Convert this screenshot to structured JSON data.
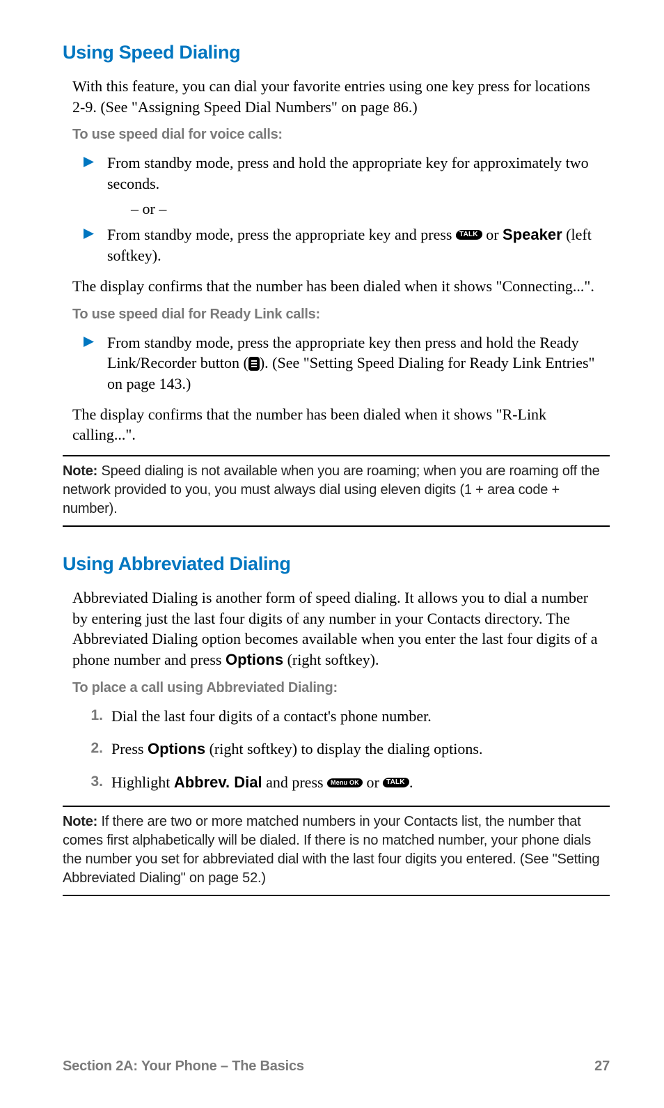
{
  "section1": {
    "heading": "Using Speed Dialing",
    "intro": "With this feature, you can dial your favorite entries using one key press for locations 2-9. (See \"Assigning Speed Dial Numbers\" on page 86.)",
    "voice_sub": "To use speed dial for voice calls:",
    "voice_b1": "From standby mode, press and hold the appropriate key for approximately two seconds.",
    "or": "– or –",
    "voice_b2_a": "From standby mode, press the appropriate key and press ",
    "talk_label": "TALK",
    "voice_b2_b": " or ",
    "speaker_bold": "Speaker",
    "voice_b2_c": " (left softkey).",
    "confirm1": "The display confirms that the number has been dialed when it shows \"Connecting...\".",
    "rl_sub": "To use speed dial for Ready Link calls:",
    "rl_b1_a": "From standby mode, press the appropriate key then press and hold the Ready Link/Recorder button (",
    "rl_b1_b": "). (See \"Setting Speed Dialing for Ready Link Entries\" on page 143.)",
    "confirm2": "The display confirms that the number has been dialed when it shows \"R-Link calling...\".",
    "note_label": "Note:",
    "note_text": " Speed dialing is not available when you are roaming; when you are roaming off the network provided to you, you must always dial using eleven digits (1 + area code + number)."
  },
  "section2": {
    "heading": "Using Abbreviated Dialing",
    "intro_a": "Abbreviated Dialing is another form of speed dialing. It allows you to dial a number by entering just the last four digits of any number in your Contacts directory. The Abbreviated Dialing option becomes available when you enter the last four digits of a phone number and press ",
    "options_bold": "Options",
    "intro_b": " (right softkey).",
    "sub": "To place a call using Abbreviated Dialing:",
    "step1_num": "1.",
    "step1": "Dial the last four digits of a contact's phone number.",
    "step2_num": "2.",
    "step2_a": "Press ",
    "step2_b": " (right softkey) to display the dialing options.",
    "step3_num": "3.",
    "step3_a": "Highlight ",
    "abbrev_bold": "Abbrev. Dial",
    "step3_b": " and press ",
    "menu_label": "Menu OK",
    "step3_c": " or ",
    "step3_d": ".",
    "note_label": "Note:",
    "note_text": " If there are two or more matched numbers in your Contacts list, the number that comes first alphabetically will be dialed. If there is no matched number, your phone dials the number you set for abbreviated dial with the last four digits you entered. (See \"Setting Abbreviated Dialing\" on page 52.)"
  },
  "footer": {
    "left": "Section 2A: Your Phone – The Basics",
    "right": "27"
  }
}
